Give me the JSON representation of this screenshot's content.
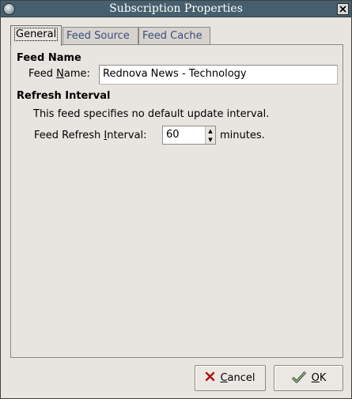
{
  "window": {
    "title": "Subscription Properties"
  },
  "tabs": [
    {
      "label": "General",
      "active": true
    },
    {
      "label": "Feed Source",
      "active": false
    },
    {
      "label": "Feed Cache",
      "active": false
    }
  ],
  "feed_name": {
    "section_title": "Feed Name",
    "field_label_pre": "Feed ",
    "field_label_mnemonic": "N",
    "field_label_post": "ame:",
    "value": "Rednova News - Technology"
  },
  "refresh": {
    "section_title": "Refresh Interval",
    "info_text": "This feed specifies no default update interval.",
    "field_label_pre": "Feed Refresh ",
    "field_label_mnemonic": "I",
    "field_label_post": "nterval:",
    "value": "60",
    "unit": "minutes."
  },
  "buttons": {
    "cancel_mnemonic": "C",
    "cancel_rest": "ancel",
    "ok_mnemonic": "O",
    "ok_rest": "K"
  },
  "icons": {
    "window_menu": "window-menu-icon",
    "close": "close-icon",
    "cancel": "x-icon",
    "ok": "checkmark-icon"
  }
}
